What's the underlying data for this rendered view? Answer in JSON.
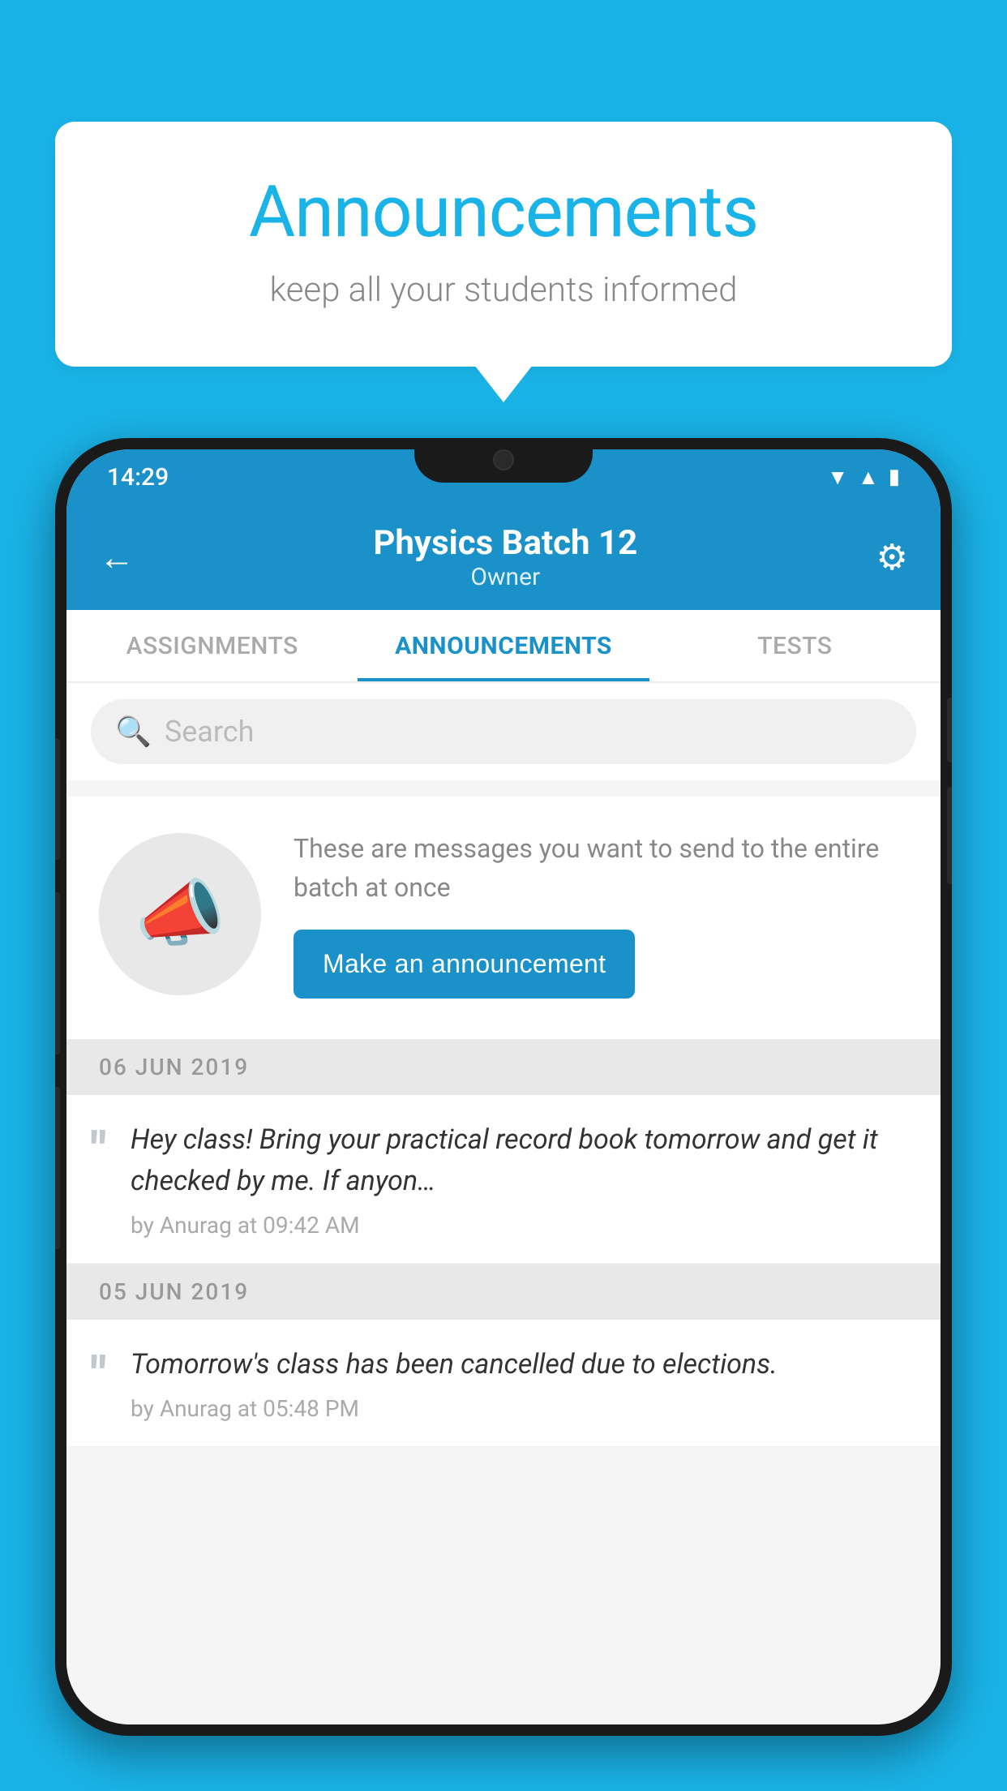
{
  "background_color": "#1ab3e8",
  "bubble": {
    "title": "Announcements",
    "subtitle": "keep all your students informed"
  },
  "phone": {
    "status_bar": {
      "time": "14:29",
      "icons": [
        "wifi",
        "signal",
        "battery"
      ]
    },
    "header": {
      "title": "Physics Batch 12",
      "subtitle": "Owner",
      "back_label": "←",
      "gear_label": "⚙"
    },
    "tabs": [
      {
        "label": "ASSIGNMENTS",
        "active": false
      },
      {
        "label": "ANNOUNCEMENTS",
        "active": true
      },
      {
        "label": "TESTS",
        "active": false
      },
      {
        "label": "...",
        "active": false
      }
    ],
    "search": {
      "placeholder": "Search"
    },
    "announcement_prompt": {
      "description": "These are messages you want to send to the entire batch at once",
      "button_label": "Make an announcement"
    },
    "announcements": [
      {
        "date": "06  JUN  2019",
        "text": "Hey class! Bring your practical record book tomorrow and get it checked by me. If anyon…",
        "meta": "by Anurag at 09:42 AM"
      },
      {
        "date": "05  JUN  2019",
        "text": "Tomorrow's class has been cancelled due to elections.",
        "meta": "by Anurag at 05:48 PM"
      }
    ]
  }
}
